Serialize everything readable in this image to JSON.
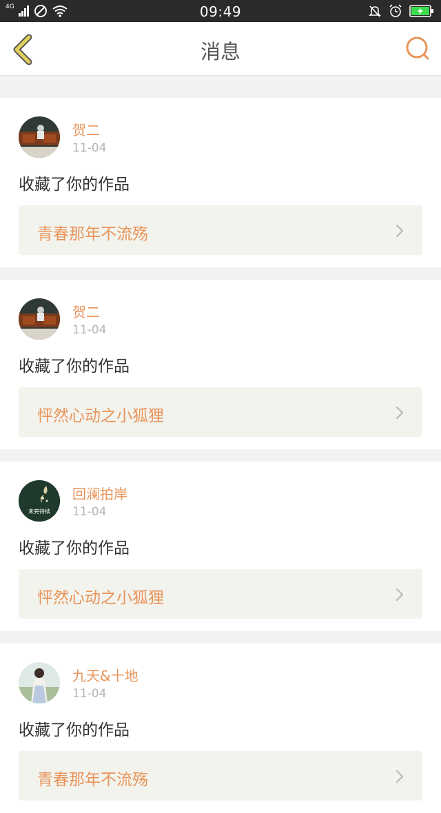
{
  "status_bar": {
    "network": "4G",
    "time": "09:49"
  },
  "nav": {
    "title": "消息",
    "back_icon": "chevron-left-icon",
    "search_icon": "search-icon",
    "accent_color": "#e8945a",
    "back_color": "#d9c24a"
  },
  "messages": [
    {
      "username": "贺二",
      "date": "11-04",
      "action": "收藏了你的作品",
      "work_title": "青春那年不流殇",
      "avatar": "photo"
    },
    {
      "username": "贺二",
      "date": "11-04",
      "action": "收藏了你的作品",
      "work_title": "怦然心动之小狐狸",
      "avatar": "photo"
    },
    {
      "username": "回澜拍岸",
      "date": "11-04",
      "action": "收藏了你的作品",
      "work_title": "怦然心动之小狐狸",
      "avatar": "dark-green",
      "avatar_text": "未完待续"
    },
    {
      "username": "九天&十地",
      "date": "11-04",
      "action": "收藏了你的作品",
      "work_title": "青春那年不流殇",
      "avatar": "portrait"
    }
  ]
}
